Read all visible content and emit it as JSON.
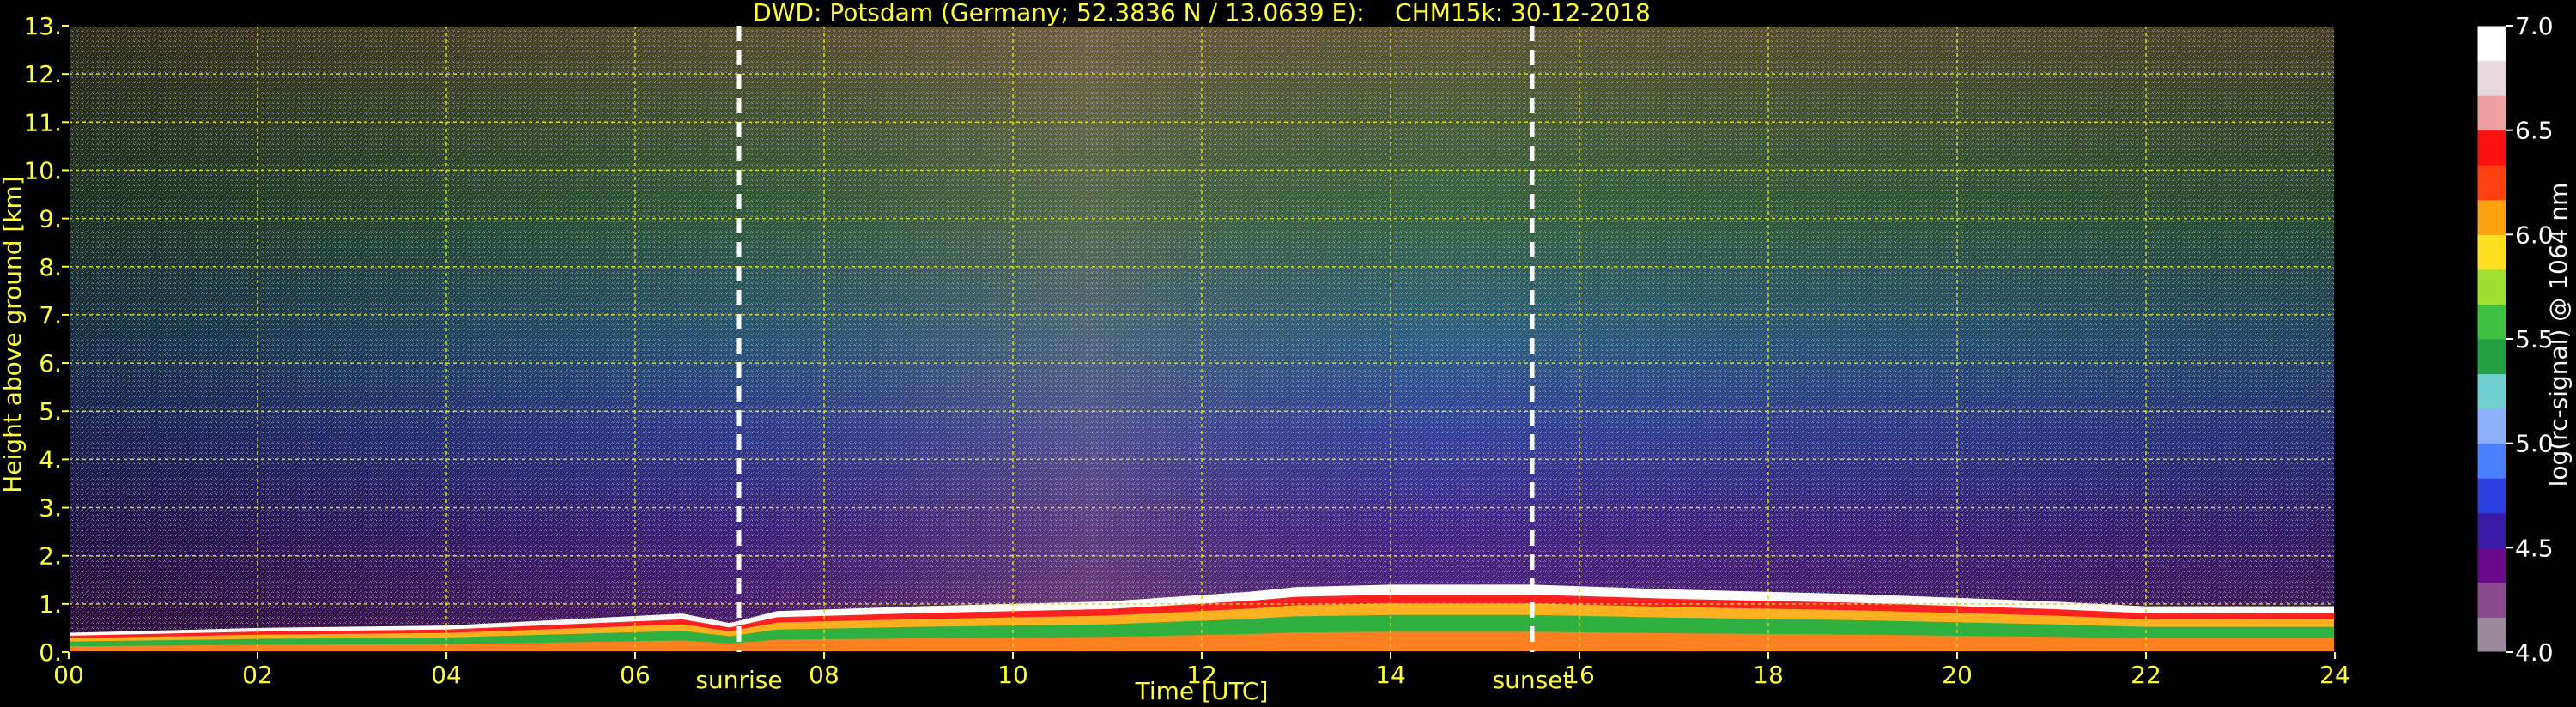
{
  "chart_data": {
    "type": "heatmap",
    "title": "DWD: Potsdam (Germany; 52.3836 N / 13.0639 E):    CHM15k: 30-12-2018",
    "xlabel": "Time [UTC]",
    "ylabel": "Height above ground [km]",
    "xlim": [
      0,
      24
    ],
    "ylim": [
      0,
      13
    ],
    "x_ticks": [
      "00",
      "02",
      "04",
      "06",
      "08",
      "10",
      "12",
      "14",
      "16",
      "18",
      "20",
      "22",
      "24"
    ],
    "x_tick_values": [
      0,
      2,
      4,
      6,
      8,
      10,
      12,
      14,
      16,
      18,
      20,
      22,
      24
    ],
    "y_ticks": [
      "0.",
      "1.",
      "2.",
      "3.",
      "4.",
      "5.",
      "6.",
      "7.",
      "8.",
      "9.",
      "10.",
      "11.",
      "12.",
      "13."
    ],
    "y_tick_values": [
      0,
      1,
      2,
      3,
      4,
      5,
      6,
      7,
      8,
      9,
      10,
      11,
      12,
      13
    ],
    "grid": true,
    "events": [
      {
        "label": "sunrise",
        "time": 7.1
      },
      {
        "label": "sunset",
        "time": 15.5
      }
    ],
    "layer_top_km": [
      [
        0,
        0.4
      ],
      [
        2,
        0.5
      ],
      [
        4,
        0.55
      ],
      [
        5.5,
        0.7
      ],
      [
        6.5,
        0.8
      ],
      [
        7,
        0.6
      ],
      [
        7.5,
        0.85
      ],
      [
        9,
        0.95
      ],
      [
        11,
        1.05
      ],
      [
        12.5,
        1.25
      ],
      [
        13,
        1.35
      ],
      [
        14,
        1.4
      ],
      [
        15.5,
        1.4
      ],
      [
        17,
        1.3
      ],
      [
        19,
        1.2
      ],
      [
        21,
        1.05
      ],
      [
        22,
        0.95
      ],
      [
        24,
        0.95
      ]
    ],
    "colorbar": {
      "label": "log(rc-signal) @ 1064 nm",
      "range": [
        4.0,
        7.0
      ],
      "ticks": [
        "4.0",
        "4.5",
        "5.0",
        "5.5",
        "6.0",
        "6.5",
        "7.0"
      ],
      "tick_values": [
        4.0,
        4.5,
        5.0,
        5.5,
        6.0,
        6.5,
        7.0
      ],
      "colors": [
        "#9a8a9a",
        "#8a4a8e",
        "#6a0a8a",
        "#3a1aa8",
        "#2a40e0",
        "#4a80ff",
        "#8ab0ff",
        "#70d0d0",
        "#20a040",
        "#40c040",
        "#a0e030",
        "#ffe020",
        "#ffa010",
        "#ff4010",
        "#ff1010",
        "#f0a0a0",
        "#e8d8e0",
        "#ffffff"
      ]
    }
  }
}
